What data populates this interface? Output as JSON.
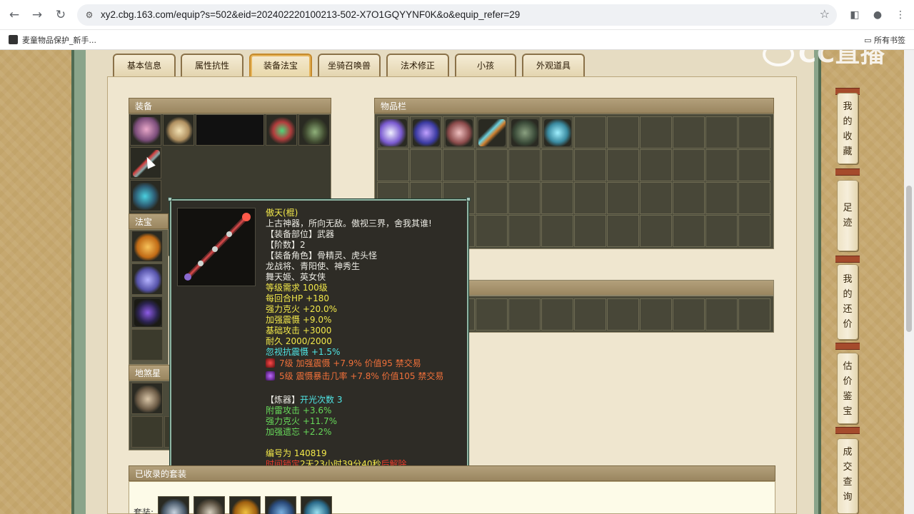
{
  "browser": {
    "url": "xy2.cbg.163.com/equip?s=502&eid=202402220100213-502-X7O1GQYYNF0K&o&equip_refer=29",
    "bookmark_1": "麦童物品保护_新手...",
    "bookmark_all": "所有书签"
  },
  "watermark": "CC直播",
  "tabs": [
    "基本信息",
    "属性抗性",
    "装备法宝",
    "坐骑召唤兽",
    "法术修正",
    "小孩",
    "外观道具"
  ],
  "active_tab": "装备法宝",
  "panels": {
    "equipment": "装备",
    "fabao": "法宝",
    "disha": "地煞星",
    "inventory": "物品栏",
    "suits": "已收录的套装",
    "suit_row_label": "套装:"
  },
  "tooltip": {
    "name": "傲天(棍)",
    "desc": "上古神器，所向无敌。傲视三界，舍我其谁!",
    "slot": "【装备部位】武器",
    "tier": "【阶数】2",
    "roles_1": "【装备角色】骨精灵、虎头怪",
    "roles_2": "龙战将、青阳使、神秀生",
    "roles_3": "舞天姬、英女侠",
    "level_req": "等级需求 100级",
    "hp_regen": "每回合HP +180",
    "ke_huo": "强力克火 +20.0%",
    "zhen_she": "加强震慑 +9.0%",
    "base_atk": "基础攻击 +3000",
    "durability": "耐久 2000/2000",
    "ignore_resist": "忽视抗震慑 +1.5%",
    "gem1": "7级 加强震慑 +7.9% 价值95 禁交易",
    "gem2": "5级 震慑暴击几率 +7.8% 价值105 禁交易",
    "refine_label": "【炼器】",
    "refine_count": "开光次数 3",
    "refine_1": "附雷攻击 +3.6%",
    "refine_2": "强力克火 +11.7%",
    "refine_3": "加强遗忘 +2.2%",
    "serial": "编号为 140819",
    "time_prefix": "时间锁定",
    "time_value": "2天23小时39分40秒",
    "time_suffix": "后解除"
  },
  "sidebar": [
    {
      "chars": [
        "我",
        "的",
        "收",
        "藏"
      ]
    },
    {
      "chars": [
        "足",
        "迹"
      ]
    },
    {
      "chars": [
        "我",
        "的",
        "还",
        "价"
      ]
    },
    {
      "chars": [
        "估",
        "价",
        "鉴",
        "宝"
      ]
    },
    {
      "chars": [
        "成",
        "交",
        "查",
        "询"
      ]
    }
  ],
  "colors": {
    "tooltip_bg": "#2e2c26",
    "tooltip_border": "#8fb6a4",
    "active_tab": "#c58a2c"
  }
}
